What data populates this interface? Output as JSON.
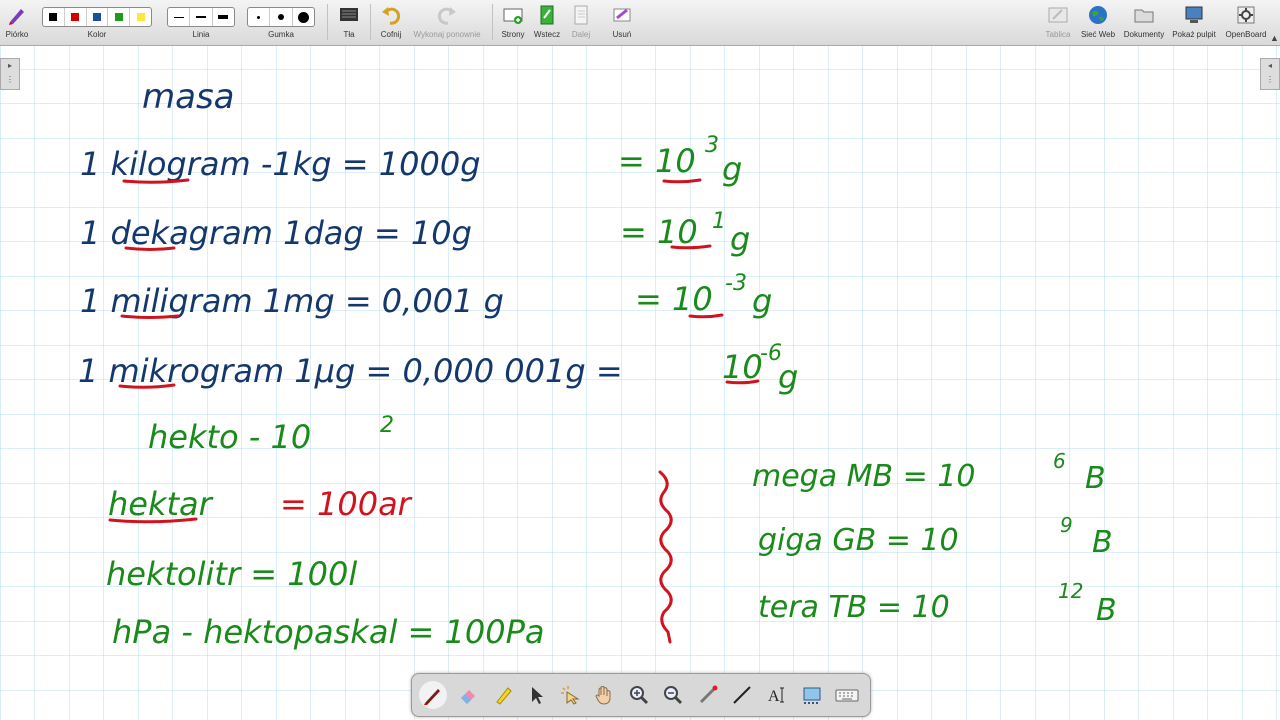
{
  "toolbar": {
    "pen_label": "Piórko",
    "color_label": "Kolor",
    "line_label": "Linia",
    "eraser_label": "Gumka",
    "background_label": "Tła",
    "undo_label": "Cofnij",
    "redo_label": "Wykonaj ponownie",
    "pages_label": "Strony",
    "back_label": "Wstecz",
    "next_label": "Dalej",
    "delete_label": "Usuń",
    "board_label": "Tablica",
    "web_label": "Sieć Web",
    "documents_label": "Dokumenty",
    "desktop_label": "Pokaż pulpit",
    "openboard_label": "OpenBoard",
    "colors": [
      "#000000",
      "#d40000",
      "#1a4fa0",
      "#1e9b1e",
      "#ffe63c"
    ]
  },
  "board": {
    "grid_color": "#b9dcf0",
    "ink": {
      "blue": "#14386e",
      "red": "#d0141e",
      "green": "#1a8a1a"
    },
    "lines": {
      "masa": "masa",
      "r1": "1 kilogram -1kg = 1000g",
      "r1_eq": "= 10",
      "r1_exp": "3",
      "r1_unit": "g",
      "r2": "1 dekagram 1dag =   10g",
      "r2_eq": "= 10",
      "r2_exp": "1",
      "r2_unit": "g",
      "r3": "1 miligram 1mg = 0,001 g",
      "r3_eq": "= 10",
      "r3_exp": "-3",
      "r3_unit": "g",
      "r4": "1 mikrogram 1μg = 0,000 001g =",
      "r4_eq": "10",
      "r4_exp": "-6",
      "r4_unit": "g",
      "hekto": "hekto - 10",
      "hekto_exp": "2",
      "hektar": "hektar",
      "hektar_eq": "= 100ar",
      "hektolitr": "hektolitr = 100l",
      "hpa": "hPa - hektopaskal = 100Pa",
      "mega": "mega   MB  = 10",
      "mega_exp": "6",
      "mega_unit": "B",
      "giga": "giga   GB  = 10",
      "giga_exp": "9",
      "giga_unit": "B",
      "tera": "tera   TB  = 10",
      "tera_exp": "12",
      "tera_unit": "B"
    }
  },
  "palette": {
    "tools": [
      "pen-icon",
      "eraser-icon",
      "marker-icon",
      "selector-icon",
      "interact-icon",
      "hand-icon",
      "zoom-in-icon",
      "zoom-out-icon",
      "laser-pointer-icon",
      "line-icon",
      "text-icon",
      "capture-icon",
      "keyboard-icon"
    ]
  }
}
